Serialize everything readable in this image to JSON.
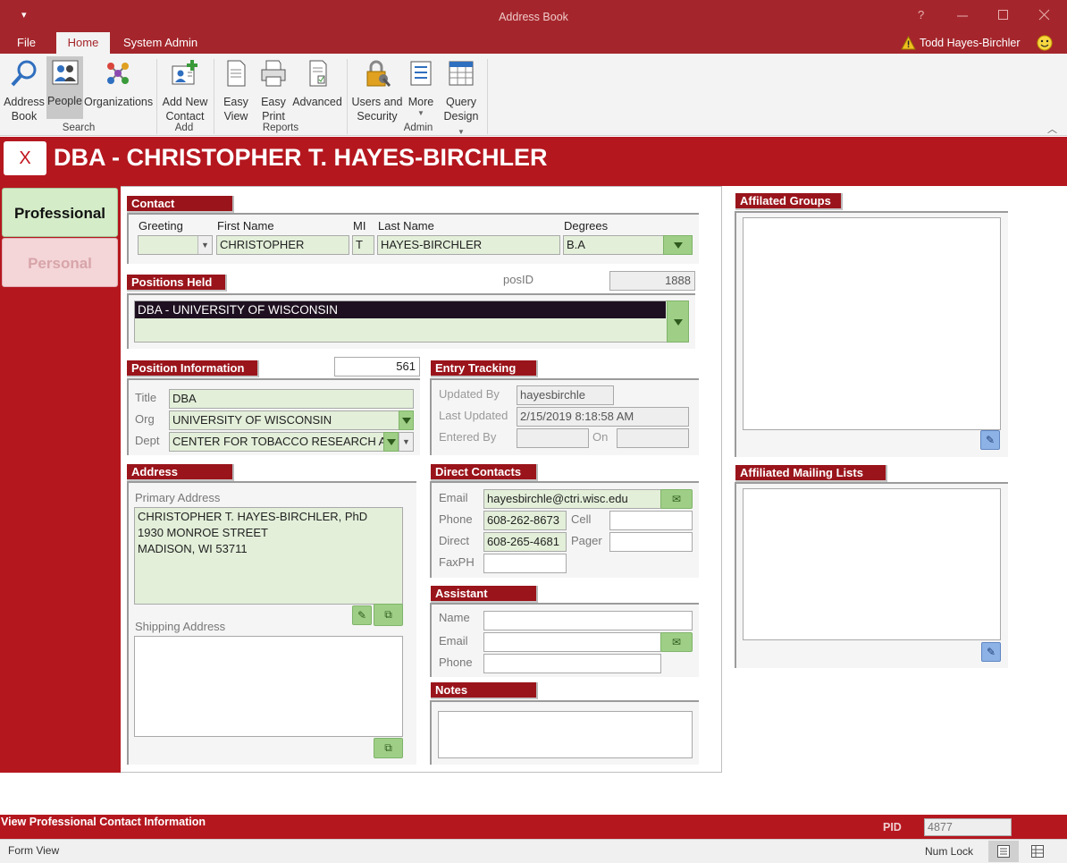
{
  "window": {
    "title": "Address Book",
    "help_glyph": "?",
    "qat_glyph": "▾",
    "user_name": "Todd Hayes-Birchler",
    "colors": {
      "brand": "#a4262c",
      "header": "#b5171f",
      "field_bg": "#e3efd9",
      "button_green": "#9fcf86"
    }
  },
  "ribbon": {
    "tabs": [
      "File",
      "Home",
      "System Admin"
    ],
    "buttons": {
      "address_book": [
        "Address",
        "Book"
      ],
      "people": [
        "People"
      ],
      "organizations": [
        "Organizations"
      ],
      "add_new_contact": [
        "Add New",
        "Contact"
      ],
      "easy_view": [
        "Easy",
        "View"
      ],
      "easy_print": [
        "Easy",
        "Print"
      ],
      "advanced": [
        "Advanced"
      ],
      "users_security": [
        "Users and",
        "Security"
      ],
      "more": [
        "More"
      ],
      "query_design": [
        "Query",
        "Design"
      ]
    },
    "groups": [
      "Search",
      "Add",
      "Reports",
      "Admin"
    ]
  },
  "record_header": {
    "close_label": "X",
    "title": "DBA - CHRISTOPHER T. HAYES-BIRCHLER"
  },
  "side_tabs": {
    "professional": "Professional",
    "personal": "Personal"
  },
  "contact": {
    "header": "Contact",
    "labels": {
      "greeting": "Greeting",
      "first_name": "First Name",
      "mi": "MI",
      "last_name": "Last Name",
      "degrees": "Degrees"
    },
    "values": {
      "greeting": "",
      "first_name": "CHRISTOPHER",
      "mi": "T",
      "last_name": "HAYES-BIRCHLER",
      "degrees": "B.A"
    }
  },
  "positions_held": {
    "header": "Positions Held",
    "posid_label": "posID",
    "posid_value": "1888",
    "selected": "DBA - UNIVERSITY OF WISCONSIN"
  },
  "position_info": {
    "header": "Position Information",
    "id_value": "561",
    "labels": {
      "title": "Title",
      "org": "Org",
      "dept": "Dept"
    },
    "values": {
      "title": "DBA",
      "org": "UNIVERSITY OF WISCONSIN",
      "dept": "CENTER FOR TOBACCO RESEARCH AND"
    }
  },
  "entry_tracking": {
    "header": "Entry Tracking",
    "labels": {
      "updated_by": "Updated By",
      "last_updated": "Last Updated",
      "entered_by": "Entered By",
      "on": "On"
    },
    "values": {
      "updated_by": "hayesbirchle",
      "last_updated": "2/15/2019 8:18:58 AM",
      "entered_by": "",
      "on": ""
    }
  },
  "address": {
    "header": "Address",
    "primary_label": "Primary Address",
    "primary_lines": [
      "CHRISTOPHER T. HAYES-BIRCHLER, PhD",
      "1930 MONROE STREET",
      "MADISON, WI 53711"
    ],
    "shipping_label": "Shipping Address",
    "shipping_value": ""
  },
  "direct_contacts": {
    "header": "Direct Contacts",
    "labels": {
      "email": "Email",
      "phone": "Phone",
      "cell": "Cell",
      "direct": "Direct",
      "pager": "Pager",
      "faxph": "FaxPH"
    },
    "values": {
      "email": "hayesbirchle@ctri.wisc.edu",
      "phone": "608-262-8673",
      "cell": "",
      "direct": "608-265-4681",
      "pager": "",
      "faxph": ""
    }
  },
  "assistant": {
    "header": "Assistant",
    "labels": {
      "name": "Name",
      "email": "Email",
      "phone": "Phone"
    },
    "values": {
      "name": "",
      "email": "",
      "phone": ""
    }
  },
  "notes": {
    "header": "Notes",
    "value": ""
  },
  "affiliated_groups": {
    "header": "Affilated Groups"
  },
  "affiliated_mailing_lists": {
    "header": "Affiliated Mailing Lists"
  },
  "footer": {
    "status_text": "View Professional Contact Information",
    "pid_label": "PID",
    "pid_value": "4877"
  },
  "statusbar": {
    "view": "Form View",
    "num_lock": "Num Lock"
  }
}
